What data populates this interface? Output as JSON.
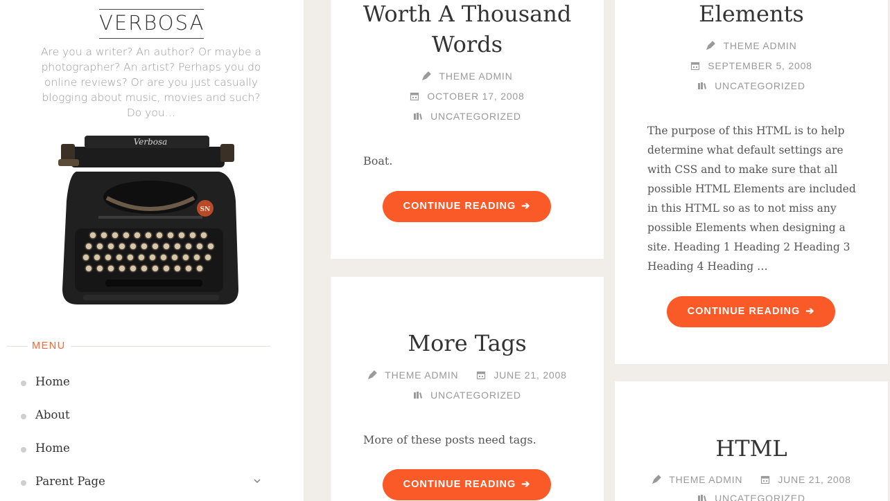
{
  "site": {
    "title": "VERBOSA",
    "tagline": "Are you a writer? An author? Or maybe a photographer? An artist? Perhaps you do online reviews? Or are you just casually blogging about music, movies and such? Do you…",
    "logo_text": "Verbosa"
  },
  "menu": {
    "heading": "MENU",
    "items": [
      {
        "label": "Home"
      },
      {
        "label": "About"
      },
      {
        "label": "Home"
      },
      {
        "label": "Parent Page"
      }
    ]
  },
  "posts": [
    {
      "title_line1": "Worth A Thousand",
      "title_line2": "Words",
      "author": "THEME ADMIN",
      "date": "OCTOBER 17, 2008",
      "category": "UNCATEGORIZED",
      "excerpt": "Boat.",
      "button": "CONTINUE READING"
    },
    {
      "title": "More Tags",
      "author": "THEME ADMIN",
      "date": "JUNE 21, 2008",
      "category": "UNCATEGORIZED",
      "excerpt": "More of these posts need tags.",
      "button": "CONTINUE READING"
    },
    {
      "title": "Elements",
      "author": "THEME ADMIN",
      "date": "SEPTEMBER 5, 2008",
      "category": "UNCATEGORIZED",
      "excerpt_lines": [
        "The purpose of this HTML is to help",
        "determine what default settings are",
        "with CSS and to make sure that all",
        "possible HTML Elements are included",
        "in this HTML so as to not miss any",
        "possible Elements when designing a",
        "site. Heading 1 Heading 2 Heading 3",
        "Heading 4 Heading …"
      ],
      "button": "CONTINUE READING"
    },
    {
      "title": "HTML",
      "author": "THEME ADMIN",
      "date": "JUNE 21, 2008",
      "category": "UNCATEGORIZED"
    }
  ],
  "icons": {
    "author": "pen-icon",
    "date": "calendar-icon",
    "category": "books-icon",
    "button_arrow": "arrow-right-icon",
    "submenu": "chevron-down-icon"
  },
  "colors": {
    "accent": "#fa5a28",
    "menu_heading": "#fa6432",
    "background": "#f1ede9",
    "card": "#ffffff"
  }
}
